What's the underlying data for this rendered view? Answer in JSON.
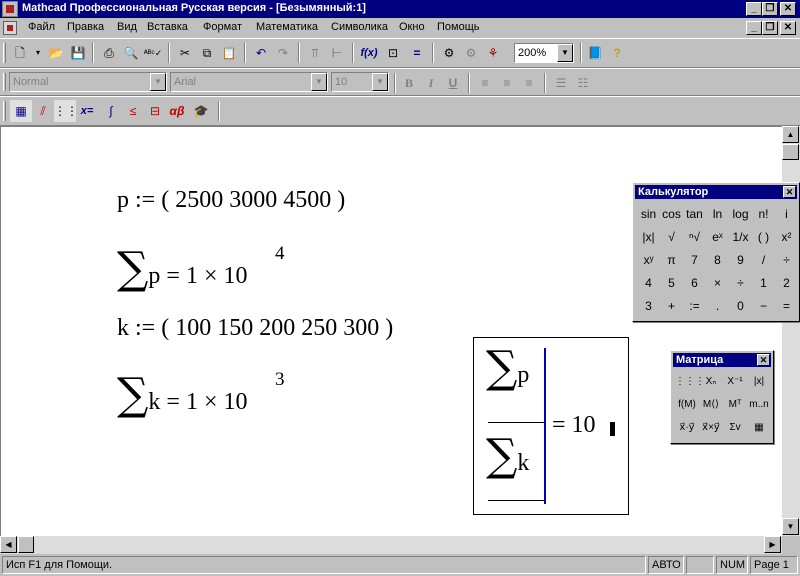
{
  "window": {
    "title": "Mathcad Профессиональная Русская версия - [Безымянный:1]"
  },
  "menubar": {
    "items": [
      "Файл",
      "Правка",
      "Вид",
      "Вставка",
      "Формат",
      "Математика",
      "Символика",
      "Окно",
      "Помощь"
    ]
  },
  "format_toolbar": {
    "style_value": "Normal",
    "font_value": "Arial",
    "size_value": "10",
    "bold_label": "B",
    "italic_label": "I",
    "underline_label": "U"
  },
  "standard_toolbar": {
    "zoom_value": "200%"
  },
  "worksheet": {
    "p_def": "p := ( 2500   3000   4500 )",
    "sum_p_lhs": "p = 1 × 10",
    "sum_p_exp": "4",
    "k_def": "k := ( 100   150   200   250   300 )",
    "sum_k_lhs": "k = 1 × 10",
    "sum_k_exp": "3",
    "frac_num_var": "p",
    "frac_den_var": "k",
    "frac_result": "= 10"
  },
  "calculator": {
    "title": "Калькулятор",
    "rows": [
      [
        "sin",
        "cos",
        "tan",
        "ln",
        "log",
        "n!",
        "i"
      ],
      [
        "|x|",
        "√",
        "ⁿ√",
        "eˣ",
        "1/x",
        "( )",
        "x²"
      ],
      [
        "xʸ",
        "π",
        "7",
        "8",
        "9",
        "/",
        "÷"
      ],
      [
        "4",
        "5",
        "6",
        "×",
        "÷",
        "1",
        "2"
      ],
      [
        "3",
        "+",
        ":=",
        ".",
        "0",
        "−",
        "="
      ]
    ]
  },
  "matrix_palette": {
    "title": "Матрица",
    "rows": [
      [
        "⋮⋮⋮",
        "Xₙ",
        "X⁻¹",
        "|x|"
      ],
      [
        "f(M)",
        "M⟨⟩",
        "Mᵀ",
        "m..n"
      ],
      [
        "x⃗·y⃗",
        "x⃗×y⃗",
        "Σv",
        "▦"
      ]
    ]
  },
  "statusbar": {
    "help_text": "Исп F1 для Помощи.",
    "mode": "АВТО",
    "numlock": "NUM",
    "page": "Page 1"
  }
}
